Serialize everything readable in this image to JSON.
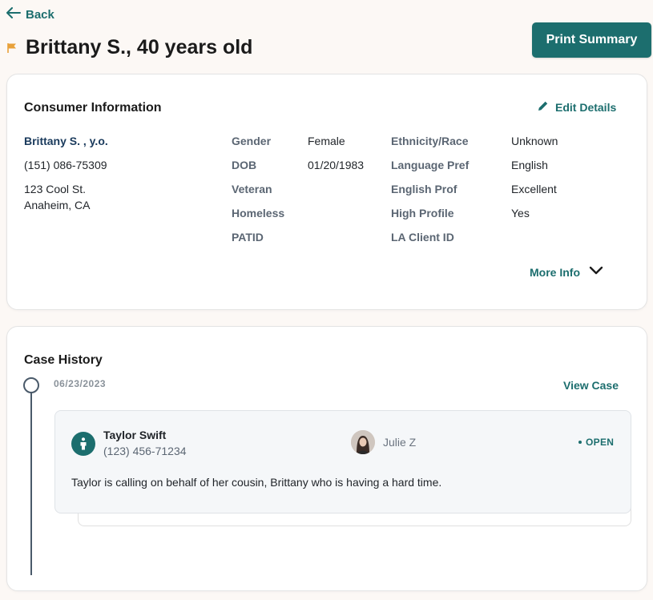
{
  "nav": {
    "back_label": "Back"
  },
  "header": {
    "title": "Brittany S., 40 years old",
    "print_label": "Print Summary"
  },
  "consumer": {
    "section_title": "Consumer Information",
    "edit_label": "Edit Details",
    "name": "Brittany S. , y.o.",
    "phone": "(151) 086-75309",
    "address_line1": "123 Cool St.",
    "address_line2": "Anaheim, CA",
    "fields_left": [
      {
        "label": "Gender",
        "value": "Female"
      },
      {
        "label": "DOB",
        "value": "01/20/1983"
      },
      {
        "label": "Veteran",
        "value": ""
      },
      {
        "label": "Homeless",
        "value": ""
      },
      {
        "label": "PATID",
        "value": ""
      }
    ],
    "fields_right": [
      {
        "label": "Ethnicity/Race",
        "value": "Unknown"
      },
      {
        "label": "Language Pref",
        "value": "English"
      },
      {
        "label": "English Prof",
        "value": "Excellent"
      },
      {
        "label": "High Profile",
        "value": "Yes"
      },
      {
        "label": "LA Client ID",
        "value": ""
      }
    ],
    "more_label": "More Info"
  },
  "history": {
    "section_title": "Case History",
    "cases": [
      {
        "date": "06/23/2023",
        "view_label": "View Case",
        "caller_name": "Taylor Swift",
        "caller_phone": "(123) 456-71234",
        "agent": "Julie Z",
        "status": "OPEN",
        "description": "Taylor is calling on behalf of her cousin, Brittany who is having a hard time."
      }
    ]
  },
  "colors": {
    "accent": "#1c6e6e",
    "flag": "#e8a13a",
    "background": "#fcf8f5",
    "name_link": "#1a3a5c"
  },
  "icons": {
    "back": "arrow-left-icon",
    "flag": "flag-icon",
    "edit": "pencil-icon",
    "more": "chevron-down-icon",
    "caller": "person-icon"
  }
}
